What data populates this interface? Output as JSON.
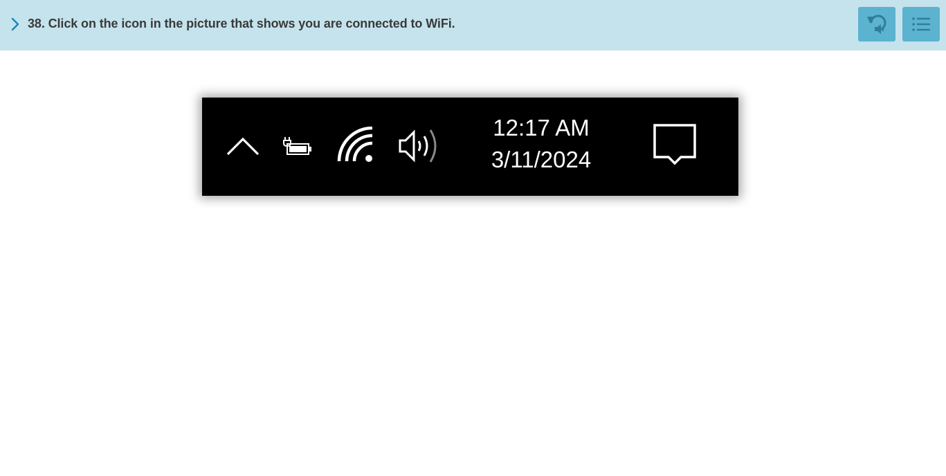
{
  "header": {
    "question": "38. Click on the icon in the picture that shows you are connected to WiFi.",
    "expand_icon": "chevron-right-icon",
    "replay_button_icon": "replay-audio-icon",
    "menu_button_icon": "list-menu-icon",
    "background_color": "#c5e3ec",
    "button_color": "#5bb3cf"
  },
  "taskbar": {
    "background_color": "#000000",
    "icons": [
      "chevron-up-icon",
      "battery-charging-icon",
      "wifi-icon",
      "volume-icon",
      "notification-icon"
    ],
    "clock": {
      "time": "12:17 AM",
      "date": "3/11/2024"
    }
  }
}
